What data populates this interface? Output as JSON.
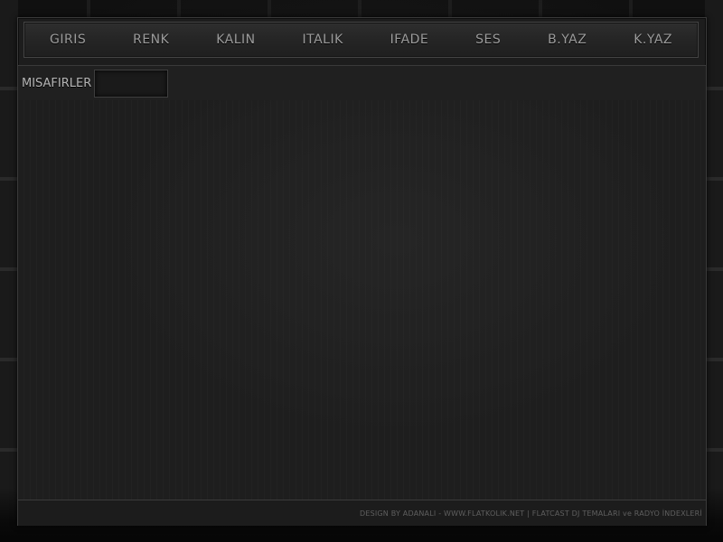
{
  "toolbar": {
    "buttons": [
      {
        "label": "GIRIS"
      },
      {
        "label": "RENK"
      },
      {
        "label": "KALIN"
      },
      {
        "label": "ITALIK"
      },
      {
        "label": "IFADE"
      },
      {
        "label": "SES"
      },
      {
        "label": "B.YAZ"
      },
      {
        "label": "K.YAZ"
      }
    ]
  },
  "guests": {
    "label": "MISAFIRLER",
    "value": ""
  },
  "footer": {
    "credits": "DESIGN BY ADANALI - WWW.FLATKOLIK.NET | FLATCAST DJ TEMALARI ve RADYO İNDEXLERİ"
  },
  "colors": {
    "frame_background": "#1d1d1d",
    "text": "#9b9b9b",
    "border": "#3a3a3a"
  }
}
